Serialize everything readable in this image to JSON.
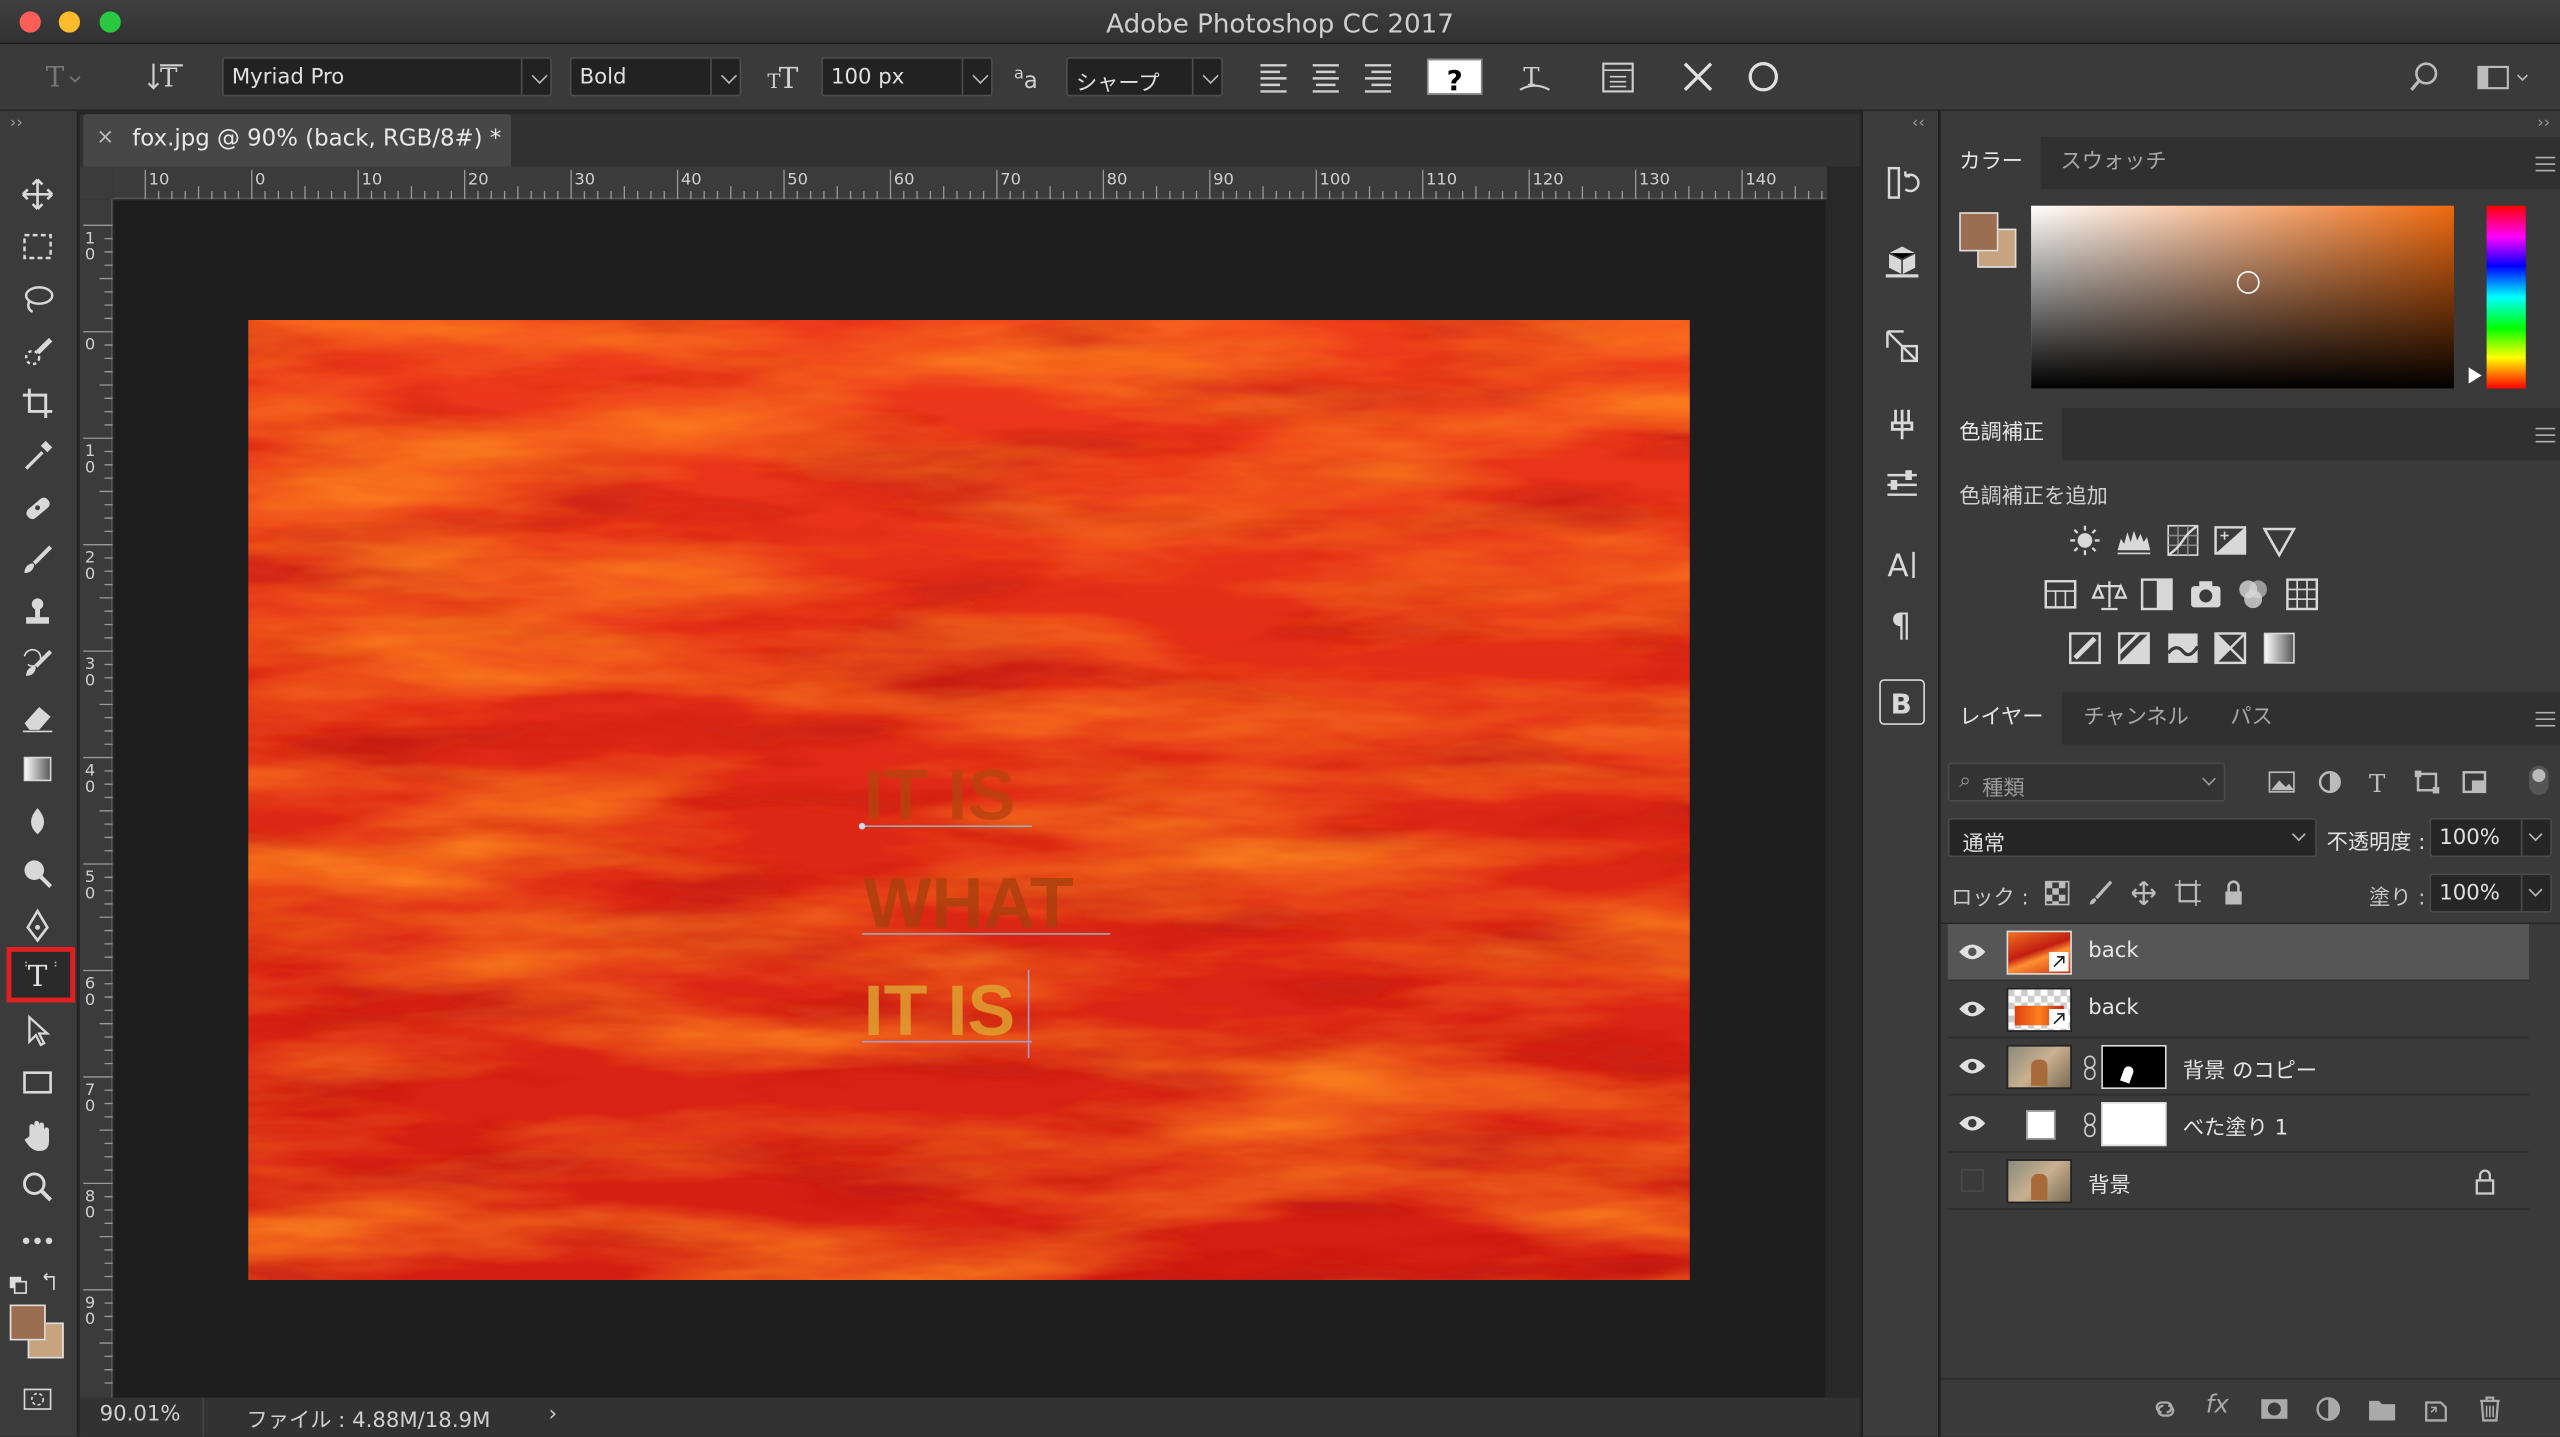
{
  "window": {
    "title": "Adobe Photoshop CC 2017"
  },
  "options": {
    "font_family": "Myriad Pro",
    "font_style": "Bold",
    "font_size": "100 px",
    "antialias": "シャープ"
  },
  "document": {
    "tab_title": "fox.jpg @ 90% (back, RGB/8#) *",
    "canvas_text": [
      "IT IS",
      "WHAT",
      "IT IS"
    ],
    "ruler_h": [
      "10",
      "0",
      "10",
      "20",
      "30",
      "40",
      "50",
      "60",
      "70",
      "80",
      "90",
      "100",
      "110",
      "120",
      "130",
      "140"
    ],
    "ruler_v": [
      "1\n0",
      "0",
      "1\n0",
      "2\n0",
      "3\n0",
      "4\n0",
      "5\n0",
      "6\n0",
      "7\n0",
      "8\n0",
      "9\n0"
    ]
  },
  "status": {
    "zoom": "90.01%",
    "file": "ファイル : 4.88M/18.9M"
  },
  "color_panel": {
    "tabs": [
      "カラー",
      "スウォッチ"
    ],
    "foreground": "#9a6e4f",
    "background": "#c8a37f"
  },
  "adjustments_panel": {
    "tab": "色調補正",
    "subtitle": "色調補正を追加"
  },
  "layers_panel": {
    "tabs": [
      "レイヤー",
      "チャンネル",
      "パス"
    ],
    "filter_placeholder": "種類",
    "blend_mode": "通常",
    "opacity_label": "不透明度 :",
    "opacity_value": "100%",
    "lock_label": "ロック :",
    "fill_label": "塗り :",
    "fill_value": "100%",
    "layers": [
      {
        "name": "back",
        "visible": true,
        "selected": true
      },
      {
        "name": "back",
        "visible": true,
        "selected": false
      },
      {
        "name": "背景 のコピー",
        "visible": true,
        "selected": false
      },
      {
        "name": "べた塗り 1",
        "visible": true,
        "selected": false
      },
      {
        "name": "背景",
        "visible": false,
        "selected": false
      }
    ]
  },
  "colors": {
    "accent_red": "#e02020",
    "sky_red": "#e8301a",
    "sky_orange": "#ff7a1a"
  }
}
